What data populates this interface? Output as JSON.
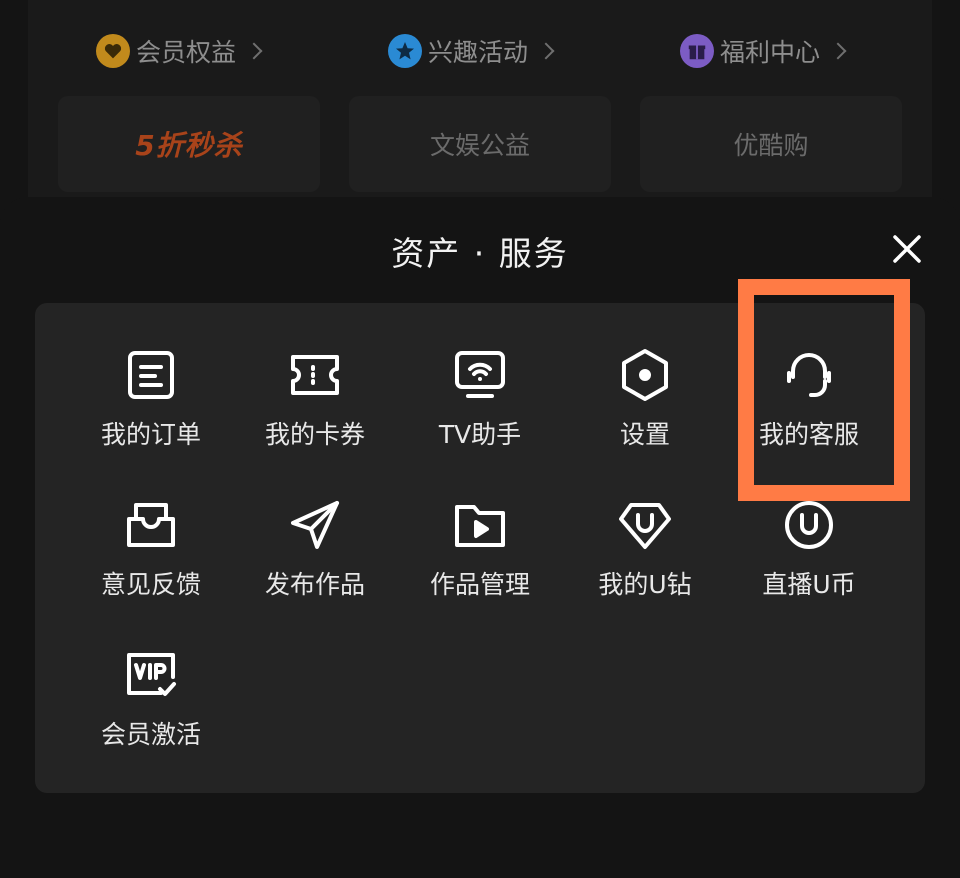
{
  "background": {
    "links": [
      {
        "label": "会员权益",
        "icon": "heart-badge-icon",
        "color": "#c18a1c"
      },
      {
        "label": "兴趣活动",
        "icon": "star-badge-icon",
        "color": "#2a8ad4"
      },
      {
        "label": "福利中心",
        "icon": "gift-badge-icon",
        "color": "#7c5cc4"
      }
    ],
    "tiles": [
      {
        "label": "5折秒杀",
        "color": "#a8431a"
      },
      {
        "label": "文娱公益"
      },
      {
        "label": "优酷购"
      }
    ]
  },
  "sheet": {
    "title": "资产 · 服务",
    "close_icon": "close-icon",
    "items": [
      {
        "label": "我的订单",
        "icon": "order-icon"
      },
      {
        "label": "我的卡券",
        "icon": "ticket-icon"
      },
      {
        "label": "TV助手",
        "icon": "tv-cast-icon"
      },
      {
        "label": "设置",
        "icon": "settings-hexagon-icon"
      },
      {
        "label": "我的客服",
        "icon": "headset-icon"
      },
      {
        "label": "意见反馈",
        "icon": "feedback-inbox-icon"
      },
      {
        "label": "发布作品",
        "icon": "paper-plane-icon"
      },
      {
        "label": "作品管理",
        "icon": "folder-play-icon"
      },
      {
        "label": "我的U钻",
        "icon": "u-diamond-icon"
      },
      {
        "label": "直播U币",
        "icon": "u-coin-icon"
      },
      {
        "label": "会员激活",
        "icon": "vip-activate-icon"
      }
    ]
  },
  "highlight_color": "#ff7b45"
}
